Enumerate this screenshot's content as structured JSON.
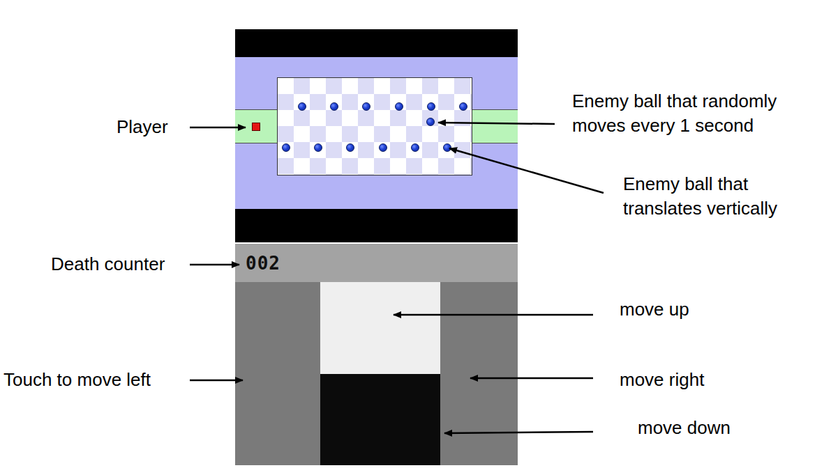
{
  "screens": {
    "top": {
      "enemies": [
        {
          "kind": "vertical"
        },
        {
          "kind": "vertical"
        },
        {
          "kind": "vertical"
        },
        {
          "kind": "vertical"
        },
        {
          "kind": "vertical"
        },
        {
          "kind": "vertical"
        },
        {
          "kind": "random"
        },
        {
          "kind": "vertical"
        },
        {
          "kind": "vertical"
        },
        {
          "kind": "vertical"
        },
        {
          "kind": "vertical"
        },
        {
          "kind": "vertical"
        },
        {
          "kind": "vertical"
        }
      ]
    },
    "bottom": {
      "death_counter": "002",
      "controls": [
        {
          "kind": "left",
          "color": "#7a7a7a"
        },
        {
          "kind": "up",
          "color": "#efefef"
        },
        {
          "kind": "down",
          "color": "#0b0b0b"
        },
        {
          "kind": "right",
          "color": "#7a7a7a"
        }
      ]
    }
  },
  "annotations": [
    {
      "label": "Player"
    },
    {
      "label": "Death counter"
    },
    {
      "label": "Touch to move left"
    },
    {
      "label": "Enemy ball that randomly moves every 1 second"
    },
    {
      "label": "Enemy ball that translates vertically"
    },
    {
      "label": "move up"
    },
    {
      "label": "move right"
    },
    {
      "label": "move down"
    }
  ]
}
